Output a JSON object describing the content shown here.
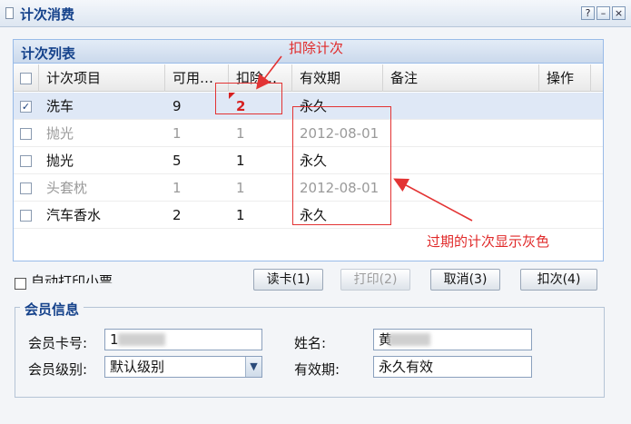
{
  "window": {
    "title": "计次消费",
    "controls": [
      "?",
      "–",
      "×"
    ]
  },
  "grid": {
    "title": "计次列表",
    "columns": [
      "计次项目",
      "可用…",
      "扣除…",
      "有效期",
      "备注",
      "操作"
    ],
    "rows": [
      {
        "checked": true,
        "expired": false,
        "item": "洗车",
        "available": "9",
        "deduct": "2",
        "validity": "永久"
      },
      {
        "checked": false,
        "expired": true,
        "item": "抛光",
        "available": "1",
        "deduct": "1",
        "validity": "2012-08-01"
      },
      {
        "checked": false,
        "expired": false,
        "item": "抛光",
        "available": "5",
        "deduct": "1",
        "validity": "永久"
      },
      {
        "checked": false,
        "expired": true,
        "item": "头套枕",
        "available": "1",
        "deduct": "1",
        "validity": "2012-08-01"
      },
      {
        "checked": false,
        "expired": false,
        "item": "汽车香水",
        "available": "2",
        "deduct": "1",
        "validity": "永久"
      }
    ]
  },
  "annotations": {
    "deduct": "扣除计次",
    "expired": "过期的计次显示灰色"
  },
  "actions": {
    "auto_print_label": "自动打印小票",
    "read_card": "读卡(1)",
    "print": "打印(2)",
    "cancel": "取消(3)",
    "deduct": "扣次(4)"
  },
  "member": {
    "legend": "会员信息",
    "card_label": "会员卡号:",
    "card_value": "1",
    "name_label": "姓名:",
    "name_value": "黄",
    "level_label": "会员级别:",
    "level_value": "默认级别",
    "expiry_label": "有效期:",
    "expiry_value": "永久有效"
  },
  "colors": {
    "title_blue": "#15428b",
    "selected_row": "#dfe8f6",
    "expired_text": "#9a9a9a",
    "annotation_red": "#e33333"
  }
}
